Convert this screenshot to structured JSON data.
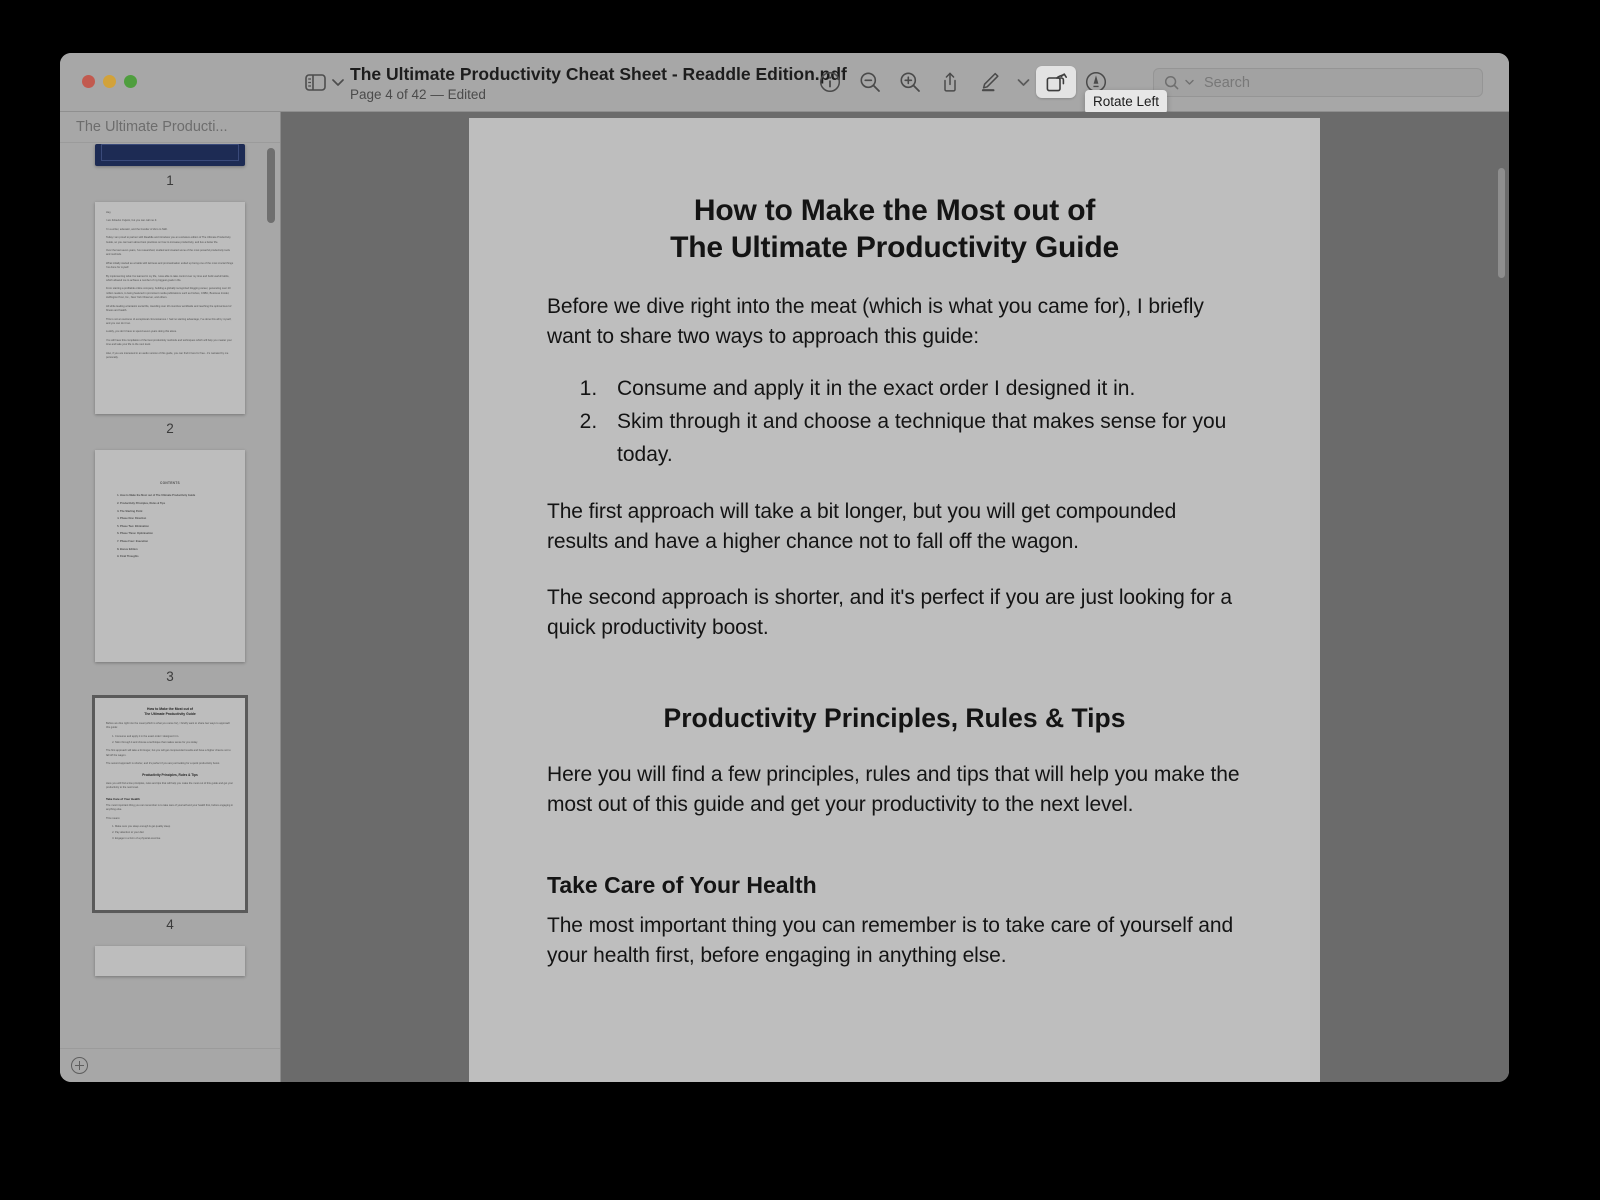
{
  "window": {
    "traffic_lights": [
      "close",
      "minimize",
      "zoom"
    ],
    "colors": {
      "close": "#c25a4f",
      "minimize": "#d2a23a",
      "zoom": "#4f9e3e",
      "canvas_bg": "#6b6b6b",
      "page_bg": "#bebebe",
      "chrome": "#a7a7a7"
    }
  },
  "toolbar": {
    "sidebar_toggle_label": "sidebar-view",
    "document_title": "The Ultimate Productivity Cheat Sheet - Readdle Edition.pdf",
    "document_subtitle": "Page 4 of 42 — Edited",
    "tools": [
      {
        "name": "info-icon",
        "label": "Info"
      },
      {
        "name": "zoom-out-icon",
        "label": "Zoom Out"
      },
      {
        "name": "zoom-in-icon",
        "label": "Zoom In"
      },
      {
        "name": "share-icon",
        "label": "Share"
      },
      {
        "name": "markup-pen-icon",
        "label": "Markup"
      },
      {
        "name": "markup-dropdown-icon",
        "label": "Markup options"
      },
      {
        "name": "rotate-left-icon",
        "label": "Rotate Left"
      },
      {
        "name": "annotate-icon",
        "label": "Annotate"
      }
    ],
    "active_tool": "rotate-left-icon",
    "tooltip": "Rotate Left",
    "search": {
      "placeholder": "Search",
      "value": ""
    }
  },
  "sidebar": {
    "header": "The Ultimate Producti...",
    "add_page_label": "+",
    "thumbnails": [
      {
        "page": "1",
        "type": "cover",
        "selected": false
      },
      {
        "page": "2",
        "type": "letter",
        "selected": false
      },
      {
        "page": "3",
        "type": "contents",
        "selected": false
      },
      {
        "page": "4",
        "type": "current",
        "selected": true
      }
    ],
    "letter_page": {
      "lines": [
        "Hey,",
        "I am Zdravko Cvijetic, but you can call me Z.",
        "I'm a writer, educator, and the founder of Zero to Skill.",
        "Today I am proud to partner with Readdle and introduce you an exclusive edition of The Ultimate Productivity Guide, so you can learn about best practices on how to increase productivity, and live a better life.",
        "Over the last seven years, I've researched, studied and created some of the most powerful productivity tools and methods.",
        "What initially started as a battle with laziness and procrastination ended up being one of the most crucial things I've done for myself.",
        "By implementing what I've learned in my life, I was able to take control over my time and build useful habits, which allowed me to achieve a number of my biggest goals in life.",
        "From starting a profitable online company, building a globally recognized blogging career, generating over 20 million readers, to being featured in prominent media publications such as Forbes, CNBC, Business Insider, Huffington Post, Inc., New York Observer, and others.",
        "All while leading a fantastic social life, travelling over 20 countries worldwide and reaching the optimal level of fitness and health.",
        "This is not an outcome of exceptional circumstances. I had no starting advantage, I've done this all by myself, and you can do it too.",
        "Luckily, you don't have to spend seven years doing this alone.",
        "You will have this compilation of the best productivity methods and techniques which will help you master your time and take your life to the next level.",
        "Also, if you are interested in an audio version of this guide, you can find it here for free - it's narrated by me personally."
      ]
    },
    "contents_page": {
      "title": "CONTENTS",
      "items": [
        "How to Make the Most out of The Ultimate Productivity Guide",
        "Productivity Principles, Rules & Tips",
        "The Starting Point",
        "Phase One: Direction",
        "Phase Two: Elimination",
        "Phase Three: Optimisation",
        "Phase Four: Execution",
        "Bonus Edition",
        "Final Thoughts"
      ]
    }
  },
  "document": {
    "title_line1": "How to Make the Most out of",
    "title_line2": "The Ultimate Productivity Guide",
    "intro": "Before we dive right into the meat (which is what you came for), I briefly want to share two ways to approach this guide:",
    "approaches": [
      "Consume and apply it in the exact order I designed it in.",
      "Skim through it and choose a technique that makes sense for you today."
    ],
    "para_first": "The first approach will take a bit longer, but you will get compounded results and have a higher chance not to fall off the wagon.",
    "para_second": "The second approach is shorter, and it's perfect if you are just looking for a quick productivity boost.",
    "section_heading": "Productivity Principles, Rules & Tips",
    "section_intro": "Here you will find a few principles, rules and tips that will help you make the most out of this guide and get your productivity to the next level.",
    "sub_heading": "Take Care of Your Health",
    "sub_para": "The most important thing you can remember is to take care of yourself and your health first, before engaging in anything else.",
    "this_means_label": "This means:",
    "this_means": [
      "Make sure you sleep enough & get quality sleep",
      "Pay attention to your diet",
      "Engage in a form of a physical exercise"
    ]
  }
}
